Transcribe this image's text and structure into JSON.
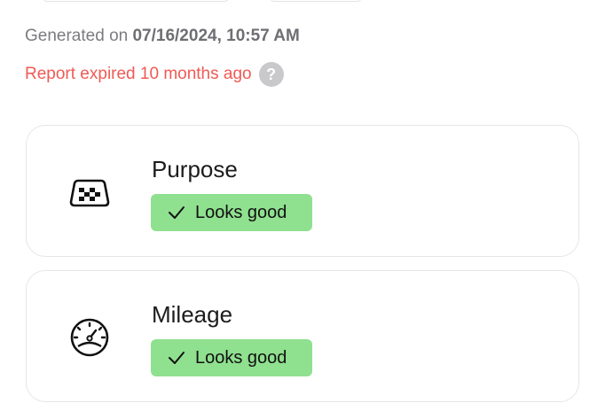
{
  "report": {
    "generated_prefix": "Generated on",
    "generated_datetime": "07/16/2024, 10:57 AM",
    "expired_text": "Report expired 10 months ago",
    "help_icon": "question-mark-icon",
    "help_glyph": "?"
  },
  "checks": [
    {
      "title": "Purpose",
      "icon": "taxi-sign-icon",
      "status": "Looks good"
    },
    {
      "title": "Mileage",
      "icon": "speedometer-icon",
      "status": "Looks good"
    }
  ],
  "colors": {
    "expired": "#ef5a55",
    "badge_bg": "#8fe08f",
    "card_border": "#e6e6e9",
    "muted_text": "#7c7c80"
  }
}
